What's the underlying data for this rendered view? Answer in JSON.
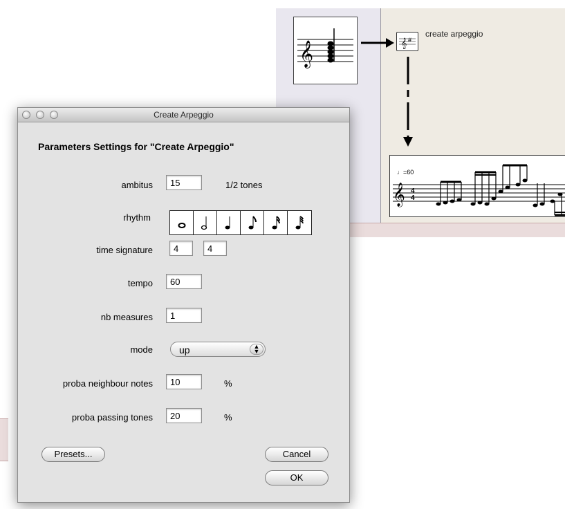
{
  "background": {
    "module": {
      "label": "create arpeggio",
      "icon": "arpeggio-module-icon"
    },
    "result_score": {
      "tempo_label": "=60"
    }
  },
  "dialog": {
    "title": "Create Arpeggio",
    "heading": "Parameters Settings for \"Create Arpeggio\"",
    "fields": {
      "ambitus": {
        "label": "ambitus",
        "value": "15",
        "unit": "1/2 tones"
      },
      "rhythm": {
        "label": "rhythm",
        "options": [
          "whole-note-icon",
          "half-note-icon",
          "quarter-note-icon",
          "eighth-note-icon",
          "sixteenth-note-icon",
          "thirty-second-note-icon"
        ]
      },
      "time_signature": {
        "label": "time signature",
        "numerator": "4",
        "denominator": "4"
      },
      "tempo": {
        "label": "tempo",
        "value": "60"
      },
      "nb_measures": {
        "label": "nb measures",
        "value": "1"
      },
      "mode": {
        "label": "mode",
        "value": "up"
      },
      "proba_neighbour": {
        "label": "proba neighbour notes",
        "value": "10",
        "unit": "%"
      },
      "proba_passing": {
        "label": "proba passing tones",
        "value": "20",
        "unit": "%"
      }
    },
    "buttons": {
      "presets": "Presets...",
      "cancel": "Cancel",
      "ok": "OK"
    }
  }
}
